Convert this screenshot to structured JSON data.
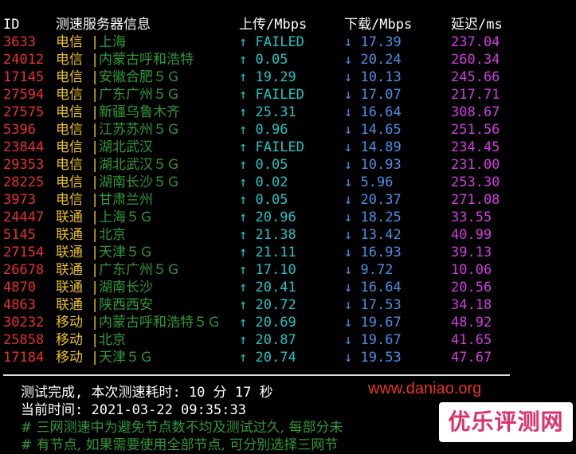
{
  "header": {
    "id": "ID",
    "node_info": "测速服务器信息",
    "upload": "上传/Mbps",
    "download": "下载/Mbps",
    "latency": "延迟/ms"
  },
  "arrows": {
    "up": "↑",
    "down": "↓",
    "separator": "|"
  },
  "rows": [
    {
      "id": "3633",
      "isp": "电信",
      "city": "上海",
      "up": "FAILED",
      "down": "17.39",
      "latency": "237.04"
    },
    {
      "id": "24012",
      "isp": "电信",
      "city": "内蒙古呼和浩特",
      "up": "0.05",
      "down": "20.24",
      "latency": "260.34"
    },
    {
      "id": "17145",
      "isp": "电信",
      "city": "安徽合肥５Ｇ",
      "up": "19.29",
      "down": "10.13",
      "latency": "245.66"
    },
    {
      "id": "27594",
      "isp": "电信",
      "city": "广东广州５Ｇ",
      "up": "FAILED",
      "down": "17.07",
      "latency": "217.71"
    },
    {
      "id": "27575",
      "isp": "电信",
      "city": "新疆乌鲁木齐",
      "up": "25.31",
      "down": "16.64",
      "latency": "308.67"
    },
    {
      "id": "5396",
      "isp": "电信",
      "city": "江苏苏州５Ｇ",
      "up": "0.96",
      "down": "14.65",
      "latency": "251.56"
    },
    {
      "id": "23844",
      "isp": "电信",
      "city": "湖北武汉",
      "up": "FAILED",
      "down": "14.89",
      "latency": "234.45"
    },
    {
      "id": "29353",
      "isp": "电信",
      "city": "湖北武汉５Ｇ",
      "up": "0.05",
      "down": "10.93",
      "latency": "231.00"
    },
    {
      "id": "28225",
      "isp": "电信",
      "city": "湖南长沙５Ｇ",
      "up": "0.02",
      "down": "5.96",
      "latency": "253.30"
    },
    {
      "id": "3973",
      "isp": "电信",
      "city": "甘肃兰州",
      "up": "0.05",
      "down": "20.37",
      "latency": "271.08"
    },
    {
      "id": "24447",
      "isp": "联通",
      "city": "上海５Ｇ",
      "up": "20.96",
      "down": "18.25",
      "latency": "33.55"
    },
    {
      "id": "5145",
      "isp": "联通",
      "city": "北京",
      "up": "21.38",
      "down": "13.42",
      "latency": "40.99"
    },
    {
      "id": "27154",
      "isp": "联通",
      "city": "天津５Ｇ",
      "up": "21.11",
      "down": "16.93",
      "latency": "39.13"
    },
    {
      "id": "26678",
      "isp": "联通",
      "city": "广东广州５Ｇ",
      "up": "17.10",
      "down": "9.72",
      "latency": "10.06"
    },
    {
      "id": "4870",
      "isp": "联通",
      "city": "湖南长沙",
      "up": "20.41",
      "down": "16.64",
      "latency": "20.56"
    },
    {
      "id": "4863",
      "isp": "联通",
      "city": "陕西西安",
      "up": "20.72",
      "down": "17.53",
      "latency": "34.18"
    },
    {
      "id": "30232",
      "isp": "移动",
      "city": "内蒙古呼和浩特５Ｇ",
      "up": "20.69",
      "down": "19.67",
      "latency": "48.92"
    },
    {
      "id": "25858",
      "isp": "移动",
      "city": "北京",
      "up": "20.87",
      "down": "19.67",
      "latency": "41.65"
    },
    {
      "id": "17184",
      "isp": "移动",
      "city": "天津５Ｇ",
      "up": "20.74",
      "down": "19.53",
      "latency": "47.67"
    }
  ],
  "summary": {
    "done": "测试完成, 本次测速耗时: 10 分 17 秒",
    "time": "当前时间: 2021-03-22 09:35:33"
  },
  "notes": [
    "# 三网测速中为避免节点数不均及测试过久, 每部分未",
    "# 有节点, 如果需要使用全部节点, 可分别选择三网节"
  ],
  "watermark": {
    "site": "www.daniao.org",
    "logo": "优乐评测网"
  },
  "colors": {
    "background": "#000000",
    "id": "#e8302e",
    "isp": "#e8c020",
    "city": "#2f9a36",
    "upload": "#22c4c4",
    "download": "#4690e8",
    "latency": "#d23ce0",
    "site": "#e8302e",
    "logo": "#e0306a"
  }
}
